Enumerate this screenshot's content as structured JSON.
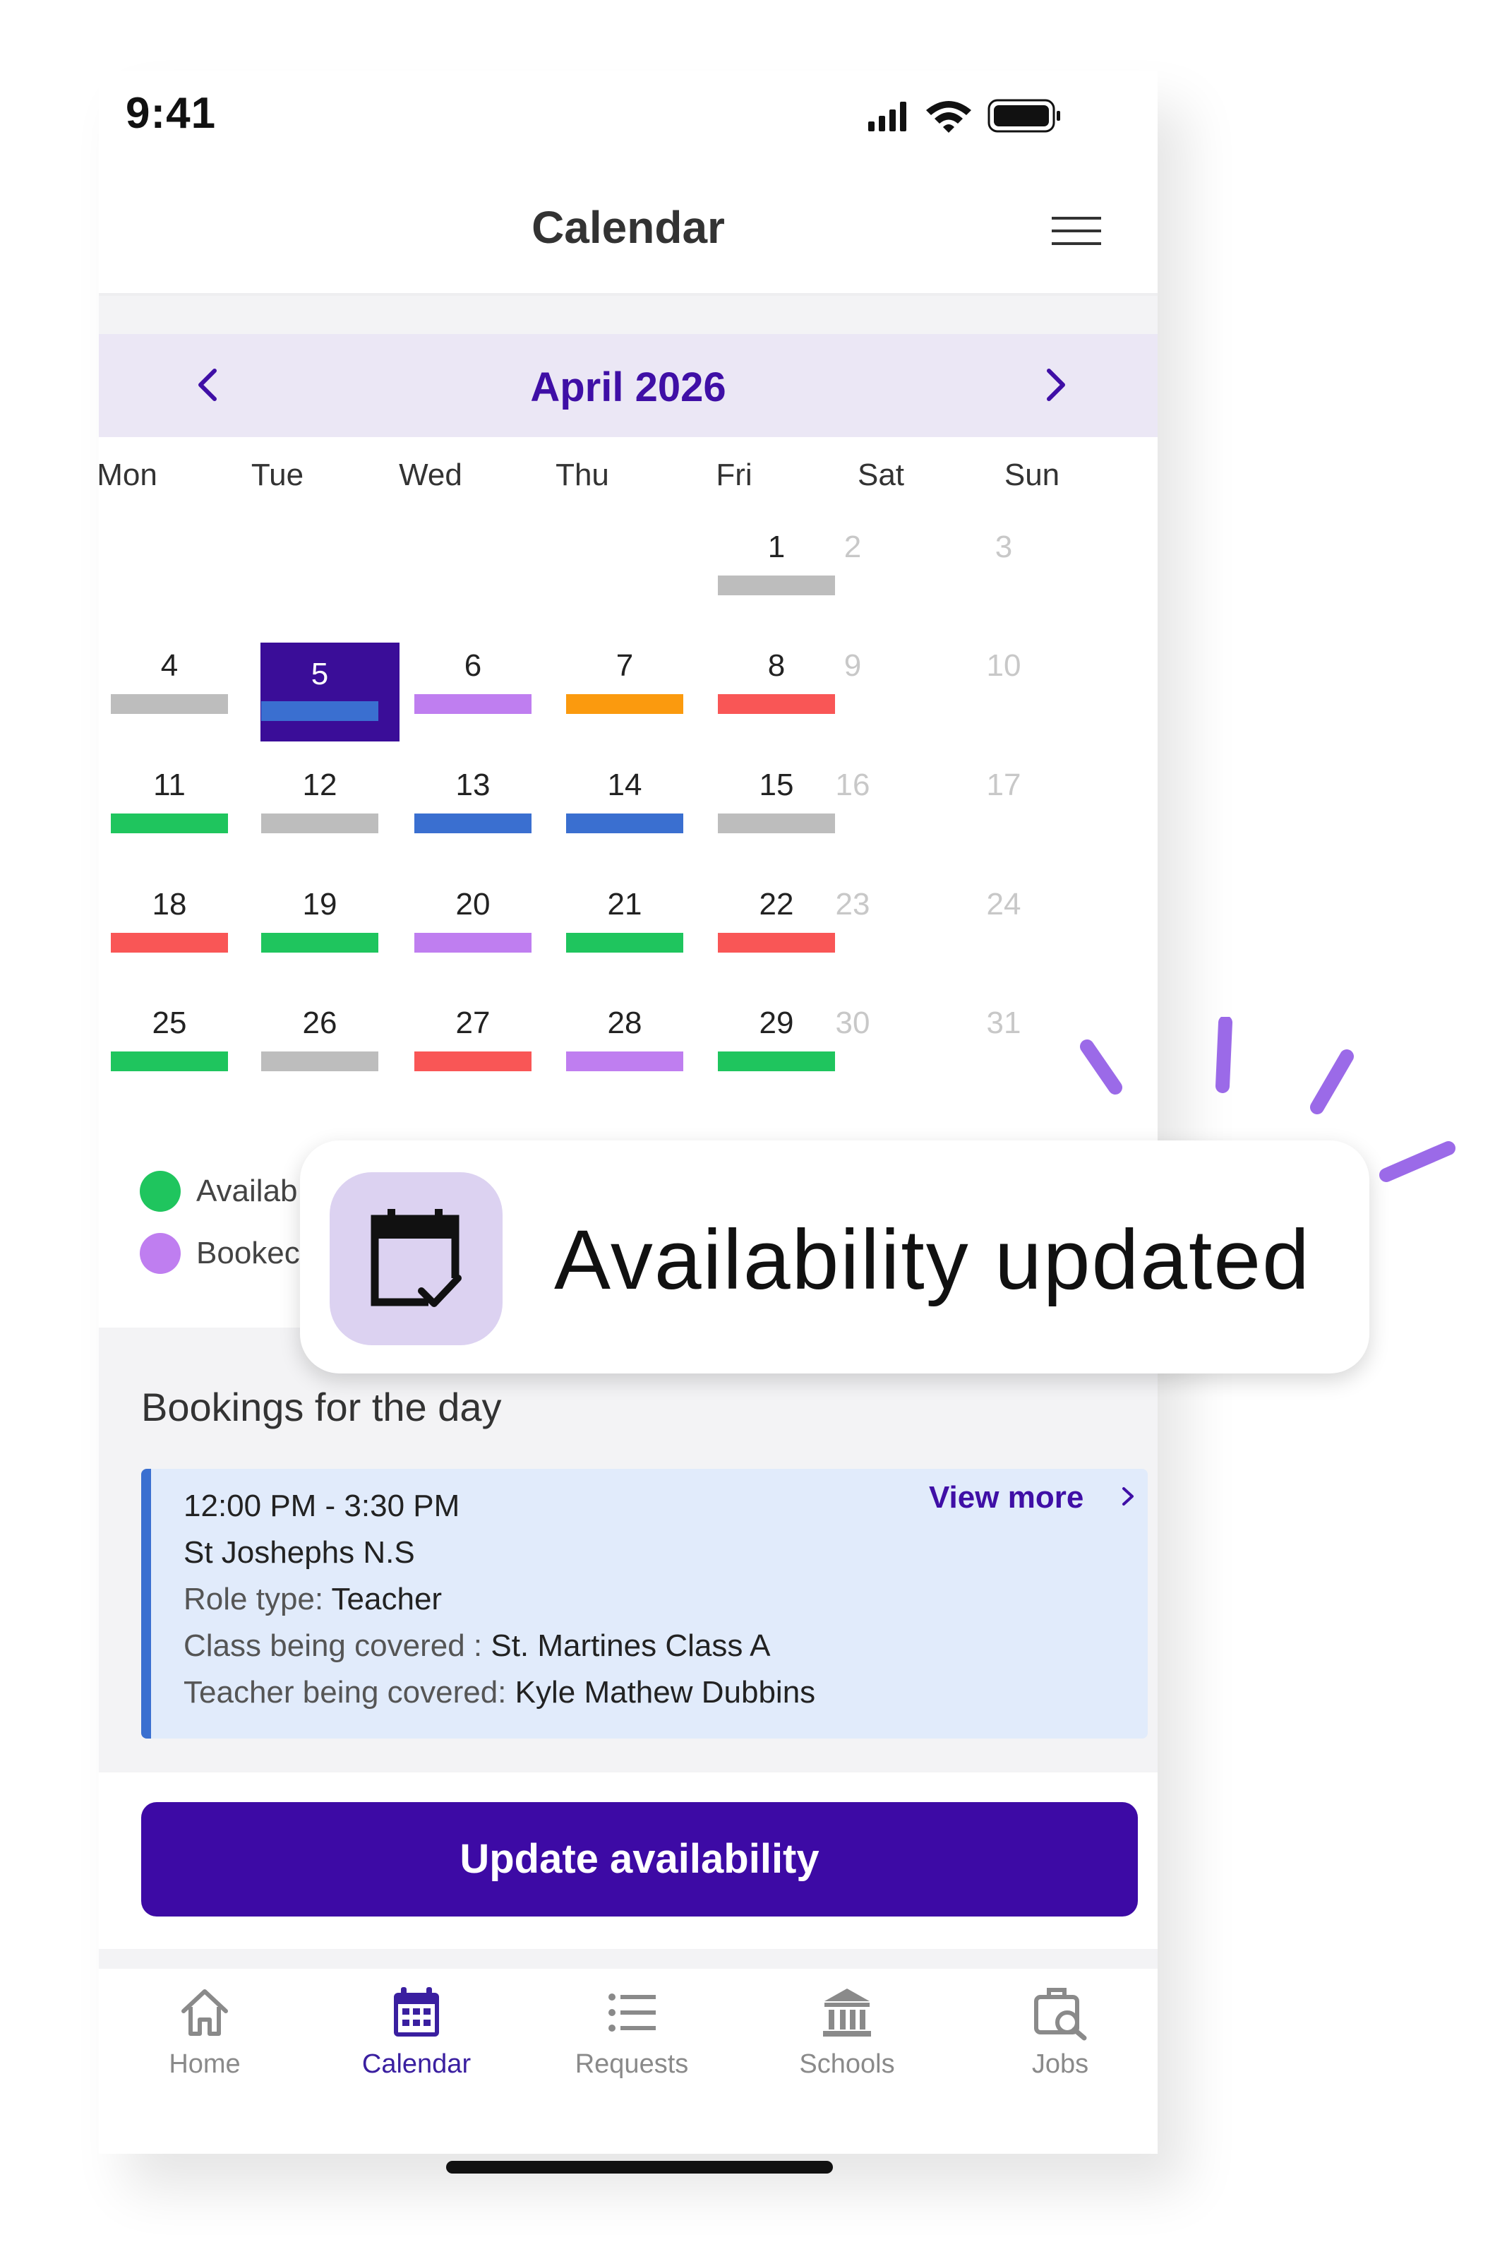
{
  "status_bar": {
    "time": "9:41"
  },
  "header": {
    "title": "Calendar"
  },
  "calendar": {
    "month_label": "April 2026",
    "weekdays": [
      "Mon",
      "Tue",
      "Wed",
      "Thu",
      "Fri",
      "Sat",
      "Sun"
    ],
    "selected_day": "5",
    "status_colors": {
      "gray": "#bdbdbd",
      "purple": "#bf7ef0",
      "orange": "#fb9a0e",
      "red": "#f95656",
      "green": "#1fc55e",
      "blue": "#3a6fd0"
    },
    "days": [
      {
        "label": "1",
        "status": "gray"
      },
      {
        "label": "2",
        "status": null
      },
      {
        "label": "3",
        "status": null
      },
      {
        "label": "4",
        "status": "gray"
      },
      {
        "label": "5",
        "status": "blue"
      },
      {
        "label": "6",
        "status": "purple"
      },
      {
        "label": "7",
        "status": "orange"
      },
      {
        "label": "8",
        "status": "red"
      },
      {
        "label": "9",
        "status": null
      },
      {
        "label": "10",
        "status": null
      },
      {
        "label": "11",
        "status": "green"
      },
      {
        "label": "12",
        "status": "gray"
      },
      {
        "label": "13",
        "status": "blue"
      },
      {
        "label": "14",
        "status": "blue"
      },
      {
        "label": "15",
        "status": "gray"
      },
      {
        "label": "16",
        "status": null
      },
      {
        "label": "17",
        "status": null
      },
      {
        "label": "18",
        "status": "red"
      },
      {
        "label": "19",
        "status": "green"
      },
      {
        "label": "20",
        "status": "purple"
      },
      {
        "label": "21",
        "status": "green"
      },
      {
        "label": "22",
        "status": "red"
      },
      {
        "label": "23",
        "status": null
      },
      {
        "label": "24",
        "status": null
      },
      {
        "label": "25",
        "status": "green"
      },
      {
        "label": "26",
        "status": "gray"
      },
      {
        "label": "27",
        "status": "red"
      },
      {
        "label": "28",
        "status": "purple"
      },
      {
        "label": "29",
        "status": "green"
      },
      {
        "label": "30",
        "status": null
      },
      {
        "label": "31",
        "status": null
      }
    ]
  },
  "legend": [
    {
      "label": "Availab",
      "color": "#1fc55e"
    },
    {
      "label": "Bookec",
      "color": "#bf7ef0"
    }
  ],
  "bookings": {
    "title": "Bookings for the day",
    "view_more": "View more",
    "time": "12:00 PM - 3:30 PM",
    "school": "St Joshephs N.S",
    "role_label": "Role type:",
    "role_value": "Teacher",
    "class_label": "Class being covered :",
    "class_value": "St. Martines Class A",
    "teacher_label": "Teacher being covered:",
    "teacher_value": "Kyle Mathew Dubbins"
  },
  "update_button": "Update availability",
  "tabs": [
    {
      "label": "Home",
      "icon": "home-icon",
      "active": false
    },
    {
      "label": "Calendar",
      "icon": "calendar-icon",
      "active": true
    },
    {
      "label": "Requests",
      "icon": "list-icon",
      "active": false
    },
    {
      "label": "Schools",
      "icon": "school-icon",
      "active": false
    },
    {
      "label": "Jobs",
      "icon": "jobs-icon",
      "active": false
    }
  ],
  "toast": {
    "text": "Availability updated",
    "icon": "calendar-check-icon"
  },
  "accent_color": "#3d0aa5"
}
